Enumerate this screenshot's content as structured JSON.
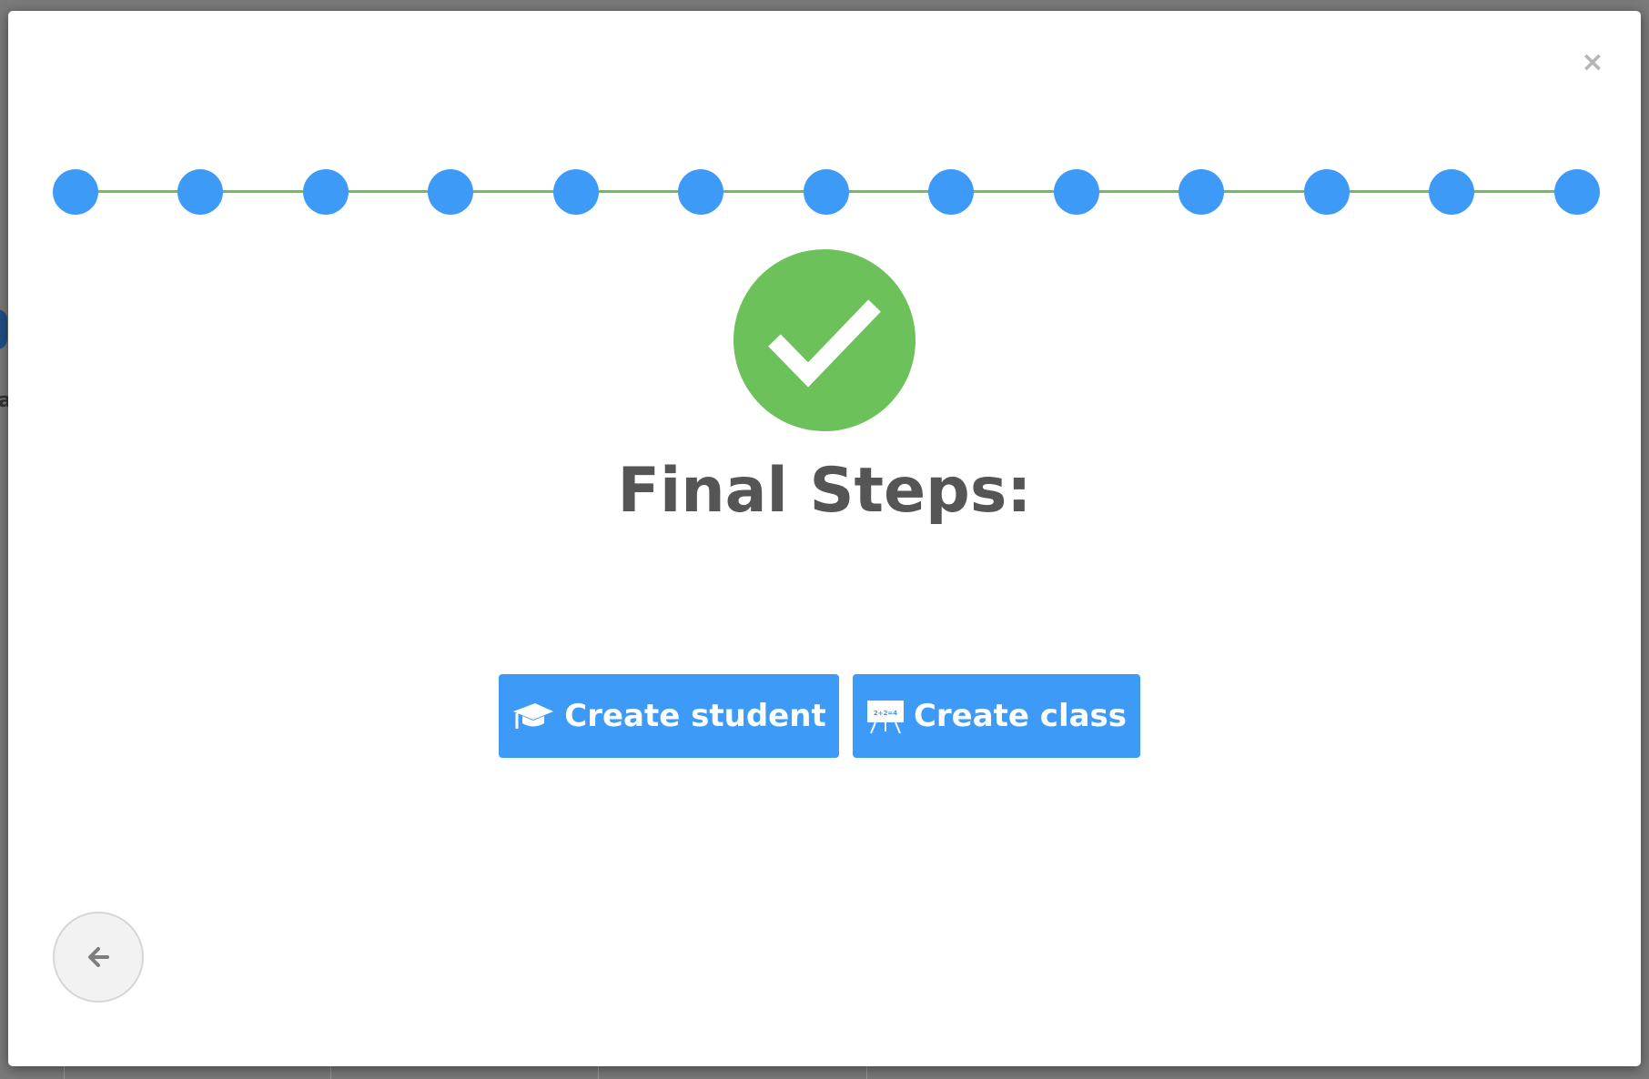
{
  "modal": {
    "close_label": "×",
    "title": "Final Steps:",
    "stepper": {
      "step_count": 13,
      "dot_color": "#3d9bf7",
      "line_color": "#6cbf5a"
    },
    "success_icon": "check-icon",
    "success_color": "#6cc15b",
    "buttons": {
      "create_student": {
        "label": "Create student",
        "icon": "graduation-cap-icon"
      },
      "create_class": {
        "label": "Create class",
        "icon": "whiteboard-icon",
        "icon_text": "2+2=4"
      }
    },
    "back_icon": "arrow-left-icon",
    "accent_color": "#3d9bf7"
  },
  "background": {
    "partial_letter": "a"
  }
}
